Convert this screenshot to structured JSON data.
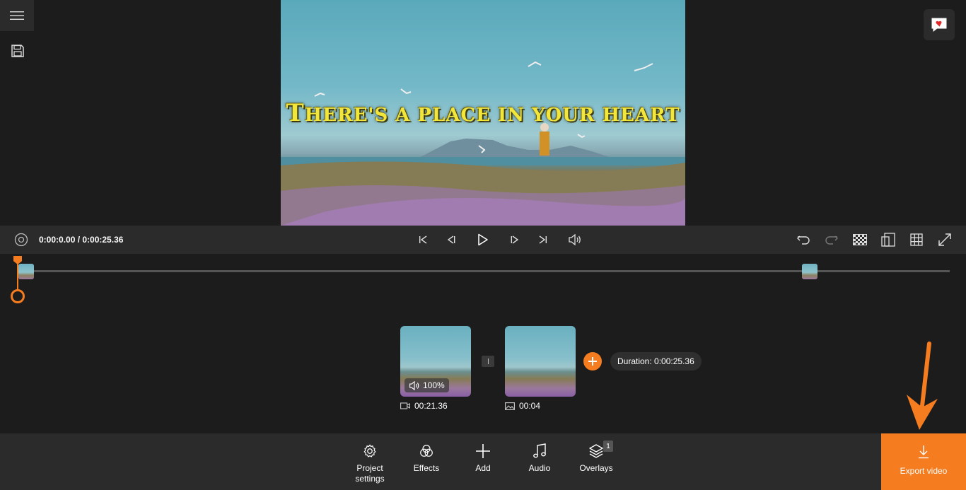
{
  "preview": {
    "caption_big": "T",
    "caption_rest": "HERE'S A PLACE IN YOUR HEART"
  },
  "transport": {
    "time": "0:00:0.00 / 0:00:25.36"
  },
  "clips": [
    {
      "volume": "100%",
      "duration": "00:21.36",
      "kind": "video"
    },
    {
      "duration": "00:04",
      "kind": "image"
    }
  ],
  "duration_label": "Duration: 0:00:25.36",
  "toolbar": {
    "items": [
      {
        "label": "Project settings",
        "icon": "gear-icon"
      },
      {
        "label": "Effects",
        "icon": "effects-icon"
      },
      {
        "label": "Add",
        "icon": "plus-icon"
      },
      {
        "label": "Audio",
        "icon": "music-note-icon"
      },
      {
        "label": "Overlays",
        "icon": "layers-icon"
      }
    ],
    "overlays_badge": "1",
    "export_label": "Export video"
  },
  "colors": {
    "accent": "#f57c1f",
    "panel": "#2b2b2b",
    "background": "#1c1c1c"
  }
}
